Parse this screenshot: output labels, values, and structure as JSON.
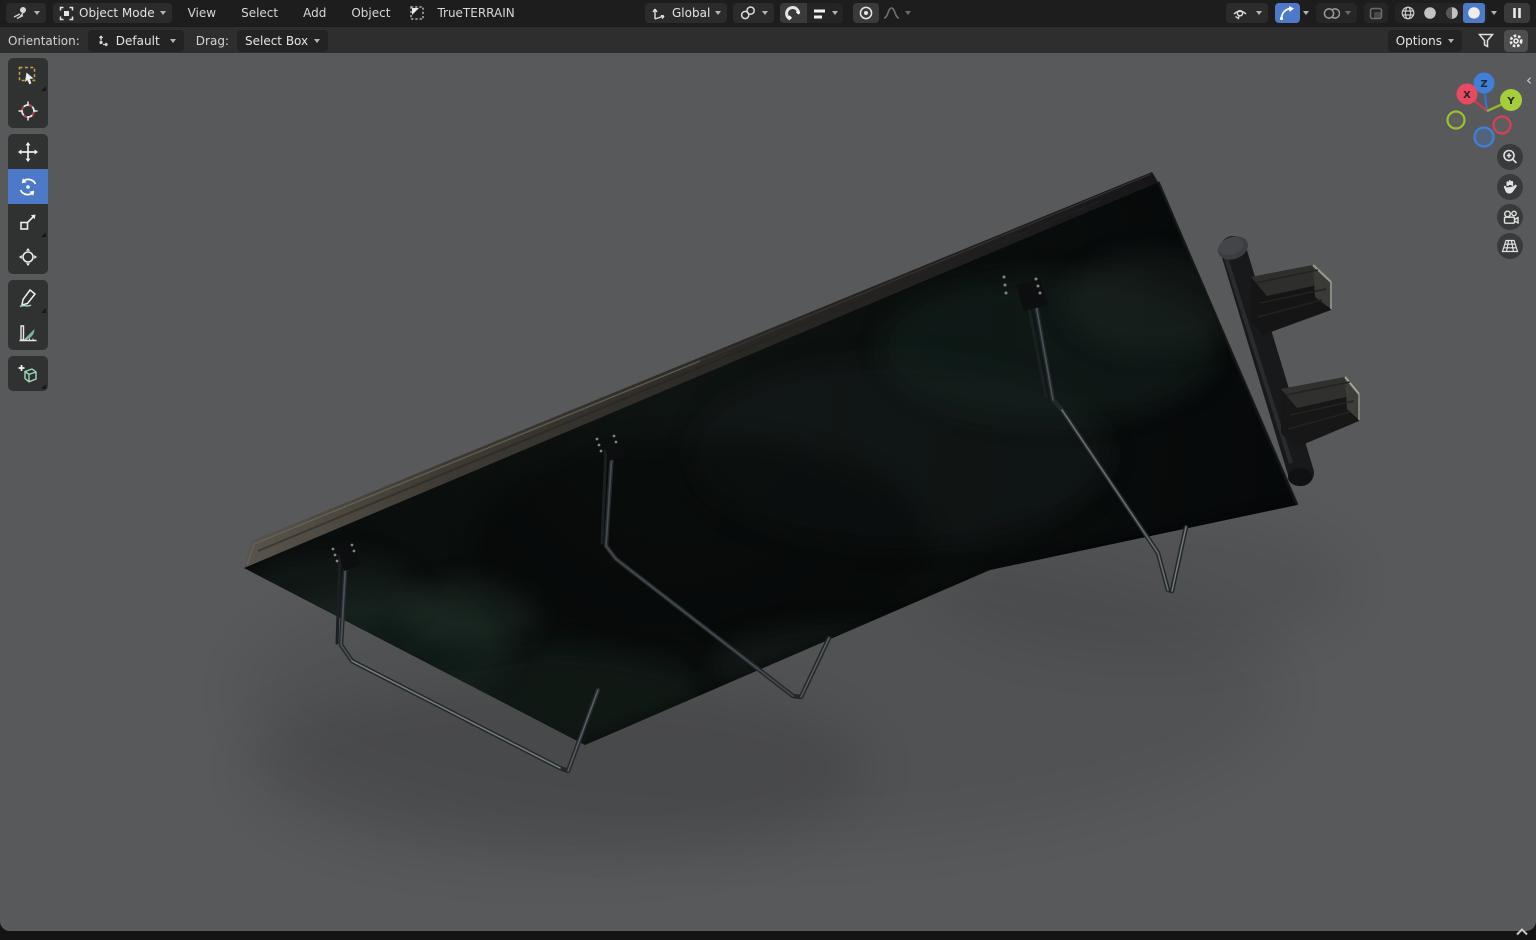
{
  "topbar": {
    "editor_type": "3d-viewport",
    "mode_label": "Object Mode",
    "menus": [
      {
        "label": "View"
      },
      {
        "label": "Select"
      },
      {
        "label": "Add"
      },
      {
        "label": "Object"
      },
      {
        "label": "TrueTERRAIN"
      }
    ],
    "transform_orientation": "Global",
    "toggles": [
      "show-object-types",
      "gizmos",
      "overlays",
      "xray",
      "snap",
      "proportional-editing"
    ],
    "shading_modes": [
      "wireframe",
      "solid",
      "material-preview",
      "rendered"
    ],
    "active_shading": "rendered",
    "pause_label": "pause"
  },
  "tool_header": {
    "orientation_label": "Orientation:",
    "orientation_value": "Default",
    "drag_label": "Drag:",
    "drag_value": "Select Box",
    "options_label": "Options"
  },
  "toolbar": {
    "active_tool": "rotate",
    "tools": [
      "select-box",
      "cursor",
      "move",
      "rotate",
      "scale",
      "transform",
      "annotate",
      "measure",
      "add-cube"
    ]
  },
  "viewport": {
    "gizmo": {
      "x_label": "X",
      "y_label": "Y",
      "z_label": "Z"
    },
    "nav_buttons": [
      "zoom",
      "pan",
      "camera-view",
      "perspective-toggle"
    ],
    "scene_object": "dark wooden shelf with wire brackets and peg hooks, viewed from below, rendered shading"
  },
  "colors": {
    "accent_blue": "#4d79c9",
    "axis_x": "#e84a5f",
    "axis_y": "#a4cf3a",
    "axis_z": "#4180d8",
    "viewport_bg": "#58595b",
    "topbar_bg": "#1d1d1d",
    "header2_bg": "#2e2e2e"
  }
}
